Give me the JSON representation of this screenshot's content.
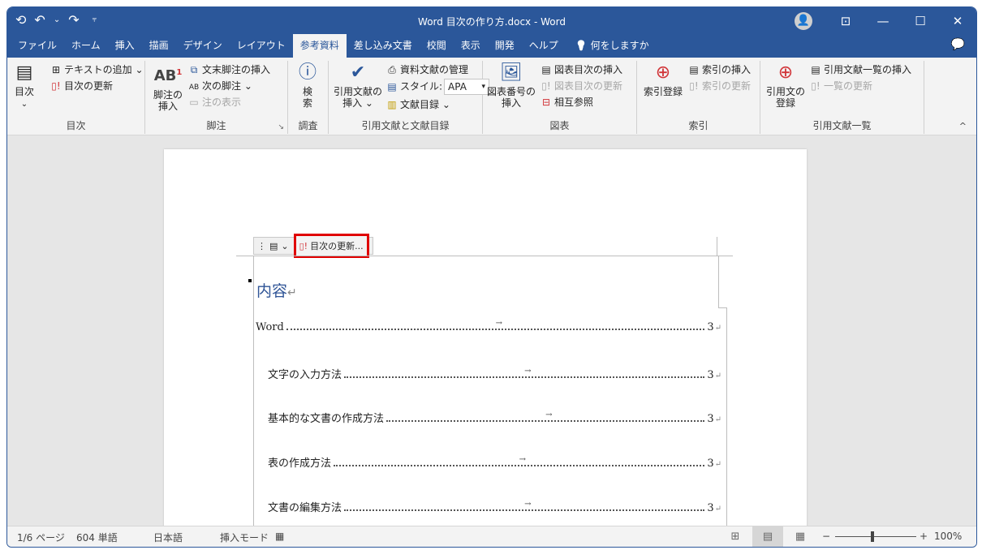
{
  "titlebar": {
    "title": "Word  目次の作り方.docx  -  Word",
    "qat": {
      "autosave_icon": "⟲",
      "undo_icon": "↶",
      "undo_dropdown": "⌄",
      "redo_icon": "↷",
      "customize_icon": "⫧"
    },
    "controls": {
      "account_icon": "👤",
      "ribbon_display_icon": "⊡",
      "minimize_icon": "—",
      "maximize_icon": "☐",
      "close_icon": "✕"
    }
  },
  "tabs": [
    {
      "label": "ファイル"
    },
    {
      "label": "ホーム"
    },
    {
      "label": "挿入"
    },
    {
      "label": "描画"
    },
    {
      "label": "デザイン"
    },
    {
      "label": "レイアウト"
    },
    {
      "label": "参考資料",
      "active": true
    },
    {
      "label": "差し込み文書"
    },
    {
      "label": "校閲"
    },
    {
      "label": "表示"
    },
    {
      "label": "開発"
    },
    {
      "label": "ヘルプ"
    }
  ],
  "tellme": {
    "icon": "💡",
    "label": "何をしますか"
  },
  "comment_icon": "💬",
  "ribbon": {
    "toc": {
      "label": "目次",
      "big": "目次",
      "big_caret": "⌄",
      "add_text": "テキストの追加 ⌄",
      "update": "目次の更新"
    },
    "footnotes": {
      "label": "脚注",
      "insert_line1": "脚注の",
      "insert_line2": "挿入",
      "endnote": "文末脚注の挿入",
      "next": "次の脚注  ⌄",
      "show": "注の表示",
      "launcher": "↘"
    },
    "research": {
      "label": "調査",
      "search_line1": "検",
      "search_line2": "索"
    },
    "citations": {
      "label": "引用文献と文献目録",
      "insert_line1": "引用文献の",
      "insert_line2": "挿入 ⌄",
      "manage": "資料文献の管理",
      "style_label": "スタイル:",
      "style_value": "APA",
      "bibliography": "文献目録 ⌄"
    },
    "captions": {
      "label": "図表",
      "insert_line1": "図表番号の",
      "insert_line2": "挿入",
      "insert_tof": "図表目次の挿入",
      "update_tof": "図表目次の更新",
      "crossref": "相互参照"
    },
    "index": {
      "label": "索引",
      "mark": "索引登録",
      "insert": "索引の挿入",
      "update": "索引の更新"
    },
    "toa": {
      "label": "引用文献一覧",
      "mark_line1": "引用文の",
      "mark_line2": "登録",
      "insert": "引用文献一覧の挿入",
      "update": "一覧の更新"
    },
    "collapse_icon": "^"
  },
  "document": {
    "toc_control": {
      "handle": "⋮",
      "icon": "▤",
      "caret": "⌄",
      "update_button": "目次の更新..."
    },
    "heading": "内容",
    "entries": [
      {
        "text": "Word",
        "page": "3",
        "indent": 0
      },
      {
        "text": "文字の入力方法",
        "page": "3",
        "indent": 1
      },
      {
        "text": "基本的な文書の作成方法",
        "page": "3",
        "indent": 1
      },
      {
        "text": "表の作成方法",
        "page": "3",
        "indent": 1
      },
      {
        "text": "文書の編集方法",
        "page": "3",
        "indent": 1
      }
    ],
    "para_mark": "↵",
    "tab_mark": "→"
  },
  "statusbar": {
    "page": "1/6 ページ",
    "words": "604 単語",
    "language": "日本語",
    "mode": "挿入モード",
    "macro_icon": "▦",
    "zoom": "100%",
    "zoom_minus": "−",
    "zoom_plus": "+",
    "zoom_level_percent": 100
  }
}
